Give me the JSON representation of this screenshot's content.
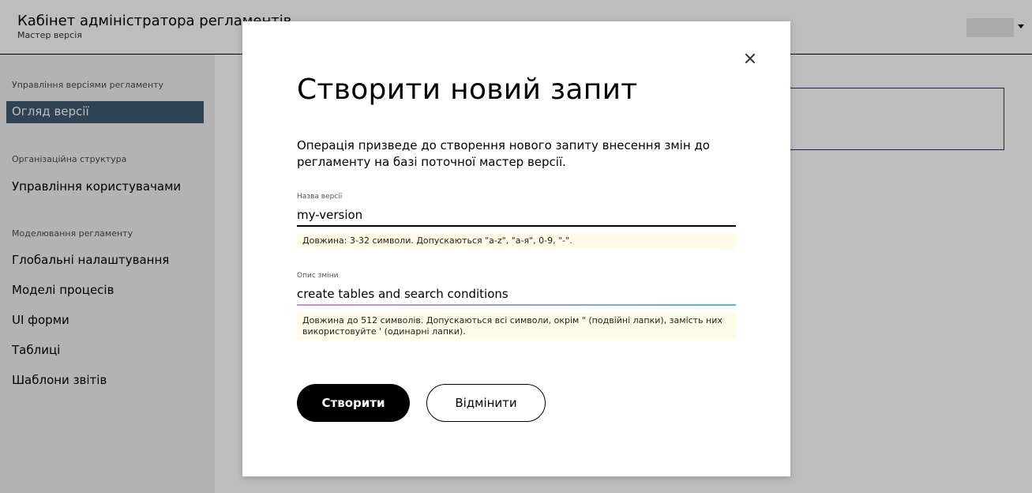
{
  "header": {
    "title": "Кабінет адміністратора регламентів",
    "subtitle": "Мастер версія"
  },
  "sidebar": {
    "sections": [
      {
        "title": "Управління версіями регламенту",
        "items": [
          "Огляд версії"
        ]
      },
      {
        "title": "Організаційна структура",
        "items": [
          "Управління користувачами"
        ]
      },
      {
        "title": "Моделювання регламенту",
        "items": [
          "Глобальні налаштування",
          "Моделі процесів",
          "UI форми",
          "Таблиці",
          "Шаблони звітів"
        ]
      }
    ],
    "active_item": "Огляд версії"
  },
  "modal": {
    "title": "Створити новий запит",
    "description": "Операція призведе до створення нового запиту внесення змін до регламенту на базі поточної мастер версії.",
    "fields": [
      {
        "label": "Назва версії",
        "value": "my-version",
        "hint": "Довжина: 3-32 символи. Допускаються \"a-z\", \"а-я\", 0-9, \"-\"."
      },
      {
        "label": "Опис зміни",
        "value": "create tables and search conditions",
        "hint": "Довжина до 512 символів. Допускаються всі символи, окрім \" (подвійні лапки), замість них використовуйте ' (одинарні лапки)."
      }
    ],
    "create_label": "Створити",
    "cancel_label": "Відмінити"
  },
  "colors": {
    "sidebar_active": "#3e5b70",
    "hint_background": "#fffbe6",
    "primary_button": "#000000",
    "focus_line_start": "#d08fc8",
    "focus_line_end": "#5fb7c9"
  },
  "icons": {
    "close": "close-icon",
    "user_menu": "chevron-down-icon"
  }
}
